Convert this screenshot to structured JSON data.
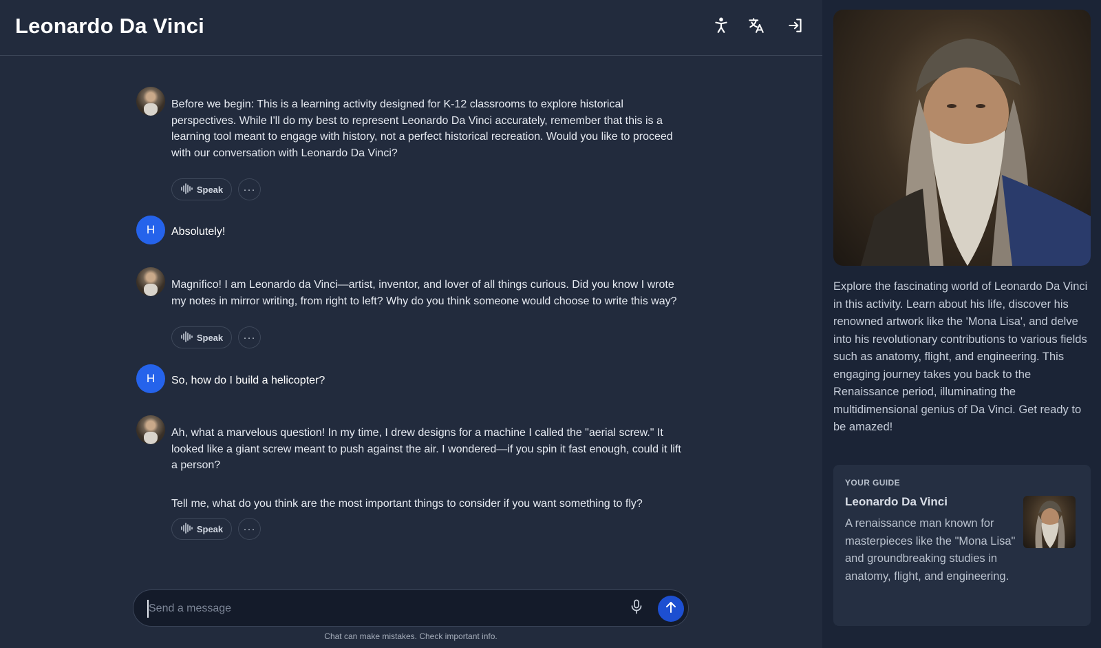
{
  "header": {
    "title": "Leonardo Da Vinci",
    "icons": [
      "accessibility-icon",
      "translate-icon",
      "sign-in-icon"
    ]
  },
  "messages": [
    {
      "role": "assistant",
      "paragraphs": [
        "Before we begin: This is a learning activity designed for K-12 classrooms to explore historical perspectives. While I'll do my best to represent Leonardo Da Vinci accurately, remember that this is a learning tool meant to engage with history, not a perfect historical recreation. Would you like to proceed with our conversation with Leonardo Da Vinci?"
      ]
    },
    {
      "role": "user",
      "initial": "H",
      "text": "Absolutely!"
    },
    {
      "role": "assistant",
      "paragraphs": [
        "Magnifico! I am Leonardo da Vinci—artist, inventor, and lover of all things curious. Did you know I wrote my notes in mirror writing, from right to left? Why do you think someone would choose to write this way?"
      ]
    },
    {
      "role": "user",
      "initial": "H",
      "text": "So, how do I build a helicopter?"
    },
    {
      "role": "assistant",
      "paragraphs": [
        "Ah, what a marvelous question! In my time, I drew designs for a machine I called the \"aerial screw.\" It looked like a giant screw meant to push against the air. I wondered—if you spin it fast enough, could it lift a person?",
        "Tell me, what do you think are the most important things to consider if you want something to fly?"
      ]
    }
  ],
  "actions": {
    "speak_label": "Speak",
    "more_label": "···"
  },
  "composer": {
    "placeholder": "Send a message",
    "value": ""
  },
  "disclaimer": "Chat can make mistakes. Check important info.",
  "sidebar": {
    "description": "Explore the fascinating world of Leonardo Da Vinci in this activity. Learn about his life, discover his renowned artwork like the 'Mona Lisa', and delve into his revolutionary contributions to various fields such as anatomy, flight, and engineering. This engaging journey takes you back to the Renaissance period, illuminating the multidimensional genius of Da Vinci. Get ready to be amazed!",
    "guide": {
      "label": "YOUR GUIDE",
      "name": "Leonardo Da Vinci",
      "description": "A renaissance man known for masterpieces like the \"Mona Lisa\" and groundbreaking studies in anatomy, flight, and engineering."
    }
  },
  "colors": {
    "accent": "#2563eb",
    "send": "#1d4fd1",
    "background": "#222b3d",
    "sidebar": "#1b2436"
  }
}
